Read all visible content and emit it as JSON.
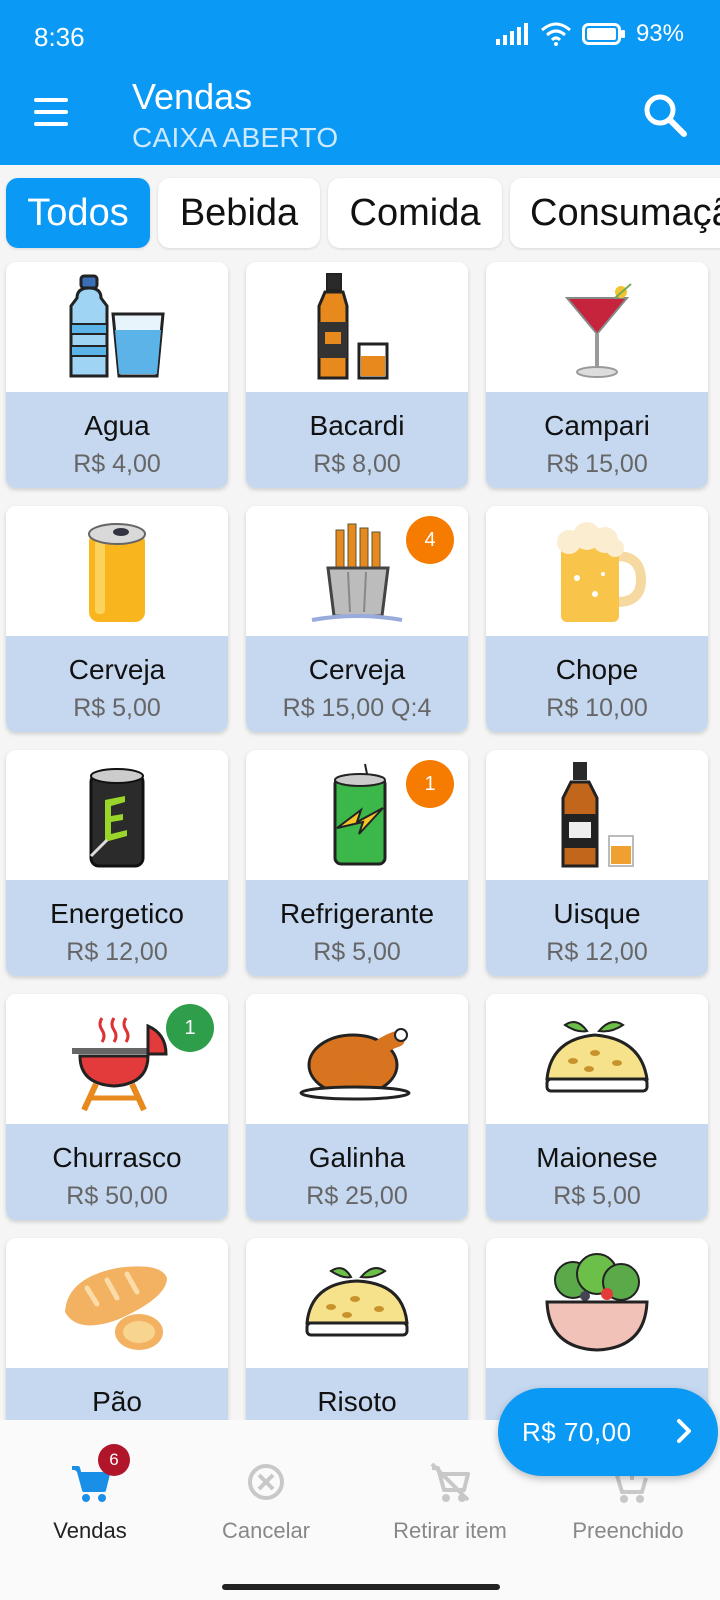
{
  "status_bar": {
    "time": "8:36",
    "battery": "93%",
    "icons": [
      "signal-icon",
      "wifi-icon",
      "battery-icon"
    ]
  },
  "app_bar": {
    "title": "Vendas",
    "subtitle": "CAIXA ABERTO",
    "icons": [
      "menu-icon",
      "search-icon"
    ]
  },
  "categories": [
    {
      "label": "Todos",
      "active": true
    },
    {
      "label": "Bebida",
      "active": false
    },
    {
      "label": "Comida",
      "active": false
    },
    {
      "label": "Consumação",
      "active": false
    }
  ],
  "products": [
    {
      "name": "Agua",
      "price": "R$ 4,00",
      "icon": "water-bottle-glass-icon"
    },
    {
      "name": "Bacardi",
      "price": "R$ 8,00",
      "icon": "liquor-bottle-glass-icon"
    },
    {
      "name": "Campari",
      "price": "R$ 15,00",
      "icon": "cocktail-glass-icon"
    },
    {
      "name": "Cerveja",
      "price": "R$ 5,00",
      "icon": "beer-can-icon"
    },
    {
      "name": "Cerveja",
      "price": "R$ 15,00 Q:4",
      "icon": "beer-bucket-icon",
      "badge": "4",
      "badge_color": "#f57c00"
    },
    {
      "name": "Chope",
      "price": "R$ 10,00",
      "icon": "beer-mug-icon"
    },
    {
      "name": "Energetico",
      "price": "R$ 12,00",
      "icon": "energy-drink-can-icon"
    },
    {
      "name": "Refrigerante",
      "price": "R$ 5,00",
      "icon": "soda-can-icon",
      "badge": "1",
      "badge_color": "#f57c00"
    },
    {
      "name": "Uisque",
      "price": "R$ 12,00",
      "icon": "whiskey-bottle-icon"
    },
    {
      "name": "Churrasco",
      "price": "R$ 50,00",
      "icon": "barbecue-grill-icon",
      "badge": "1",
      "badge_color": "#2e9e4a"
    },
    {
      "name": "Galinha",
      "price": "R$ 25,00",
      "icon": "roast-chicken-icon"
    },
    {
      "name": "Maionese",
      "price": "R$ 5,00",
      "icon": "salad-plate-icon"
    },
    {
      "name": "Pão",
      "price": "",
      "icon": "bread-icon"
    },
    {
      "name": "Risoto",
      "price": "",
      "icon": "risotto-plate-icon"
    },
    {
      "name": "",
      "price": "",
      "icon": "salad-bowl-icon"
    }
  ],
  "total_button": {
    "label": "R$ 70,00"
  },
  "bottom_nav": {
    "cart_count": "6",
    "items": [
      {
        "label": "Vendas",
        "icon": "cart-icon",
        "active": true
      },
      {
        "label": "Cancelar",
        "icon": "cancel-circle-icon",
        "active": false
      },
      {
        "label": "Retirar item",
        "icon": "cart-remove-icon",
        "active": false
      },
      {
        "label": "Preenchido",
        "icon": "cart-add-icon",
        "active": false
      }
    ]
  },
  "colors": {
    "primary": "#0a99f4",
    "card_info_bg": "#c5d8f0",
    "badge_orange": "#f57c00",
    "badge_green": "#2e9e4a",
    "cart_badge": "#b0152a"
  }
}
